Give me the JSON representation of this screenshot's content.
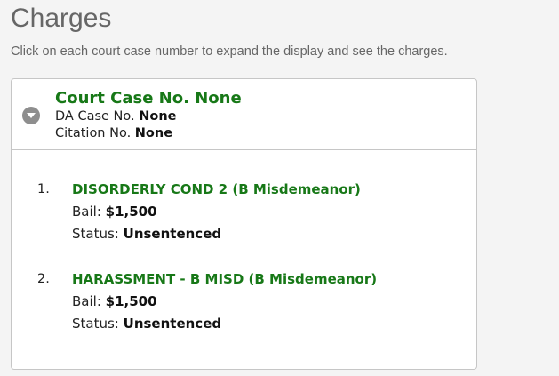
{
  "page": {
    "heading": "Charges",
    "instructions": "Click on each court case number to expand the display and see the charges."
  },
  "case": {
    "title": "Court Case No. None",
    "da_label": "DA Case No.",
    "da_value": "None",
    "citation_label": "Citation No.",
    "citation_value": "None",
    "toggle_icon": "chevron-down-icon",
    "expanded": true
  },
  "charges": [
    {
      "number": "1.",
      "title": "DISORDERLY COND 2 (B Misdemeanor)",
      "bail_label": "Bail:",
      "bail_value": "$1,500",
      "status_label": "Status:",
      "status_value": "Unsentenced"
    },
    {
      "number": "2.",
      "title": "HARASSMENT - B MISD (B Misdemeanor)",
      "bail_label": "Bail:",
      "bail_value": "$1,500",
      "status_label": "Status:",
      "status_value": "Unsentenced"
    }
  ],
  "colors": {
    "accent_green": "#177817",
    "heading_gray": "#666666",
    "border": "#c6c6c6",
    "icon_gray": "#8e8e8e"
  }
}
